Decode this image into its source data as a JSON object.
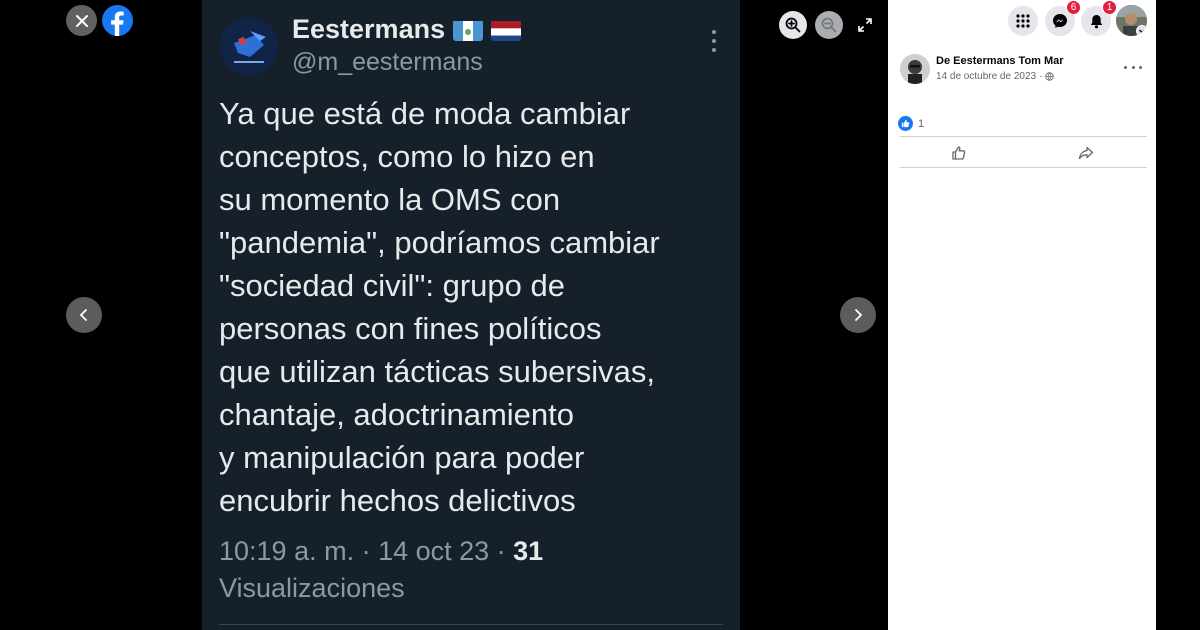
{
  "viewer": {
    "icons": {
      "close": "close-icon",
      "facebook": "facebook-logo",
      "zoom_in": "zoom-in-icon",
      "zoom_out": "zoom-out-icon",
      "fullscreen": "fullscreen-icon",
      "previous": "chevron-left-icon",
      "next": "chevron-right-icon"
    }
  },
  "tweet": {
    "display_name": "Eestermans",
    "flags": [
      "guatemala-flag",
      "netherlands-flag"
    ],
    "handle": "@m_eestermans",
    "text_lines": [
      "Ya que está de moda cambiar",
      "conceptos, como lo hizo en",
      "su momento la OMS con",
      "\"pandemia\", podríamos cambiar",
      "\"sociedad civil\": grupo de",
      "personas con fines políticos",
      "que utilizan tácticas subersivas,",
      "chantaje, adoctrinamiento",
      "y manipulación para poder",
      "encubrir hechos delictivos"
    ],
    "timestamp": "10:19 a. m. · 14 oct 23 · ",
    "views_count": "31",
    "views_label": "Visualizaciones",
    "colors": {
      "background": "#15202b",
      "text": "#e7e9ea",
      "muted": "#8b98a5"
    }
  },
  "topbar": {
    "menu_icon": "grid-menu-icon",
    "messenger_icon": "messenger-icon",
    "messenger_badge": "6",
    "notifications_icon": "bell-icon",
    "notifications_badge": "1",
    "account_icon": "account-avatar"
  },
  "post": {
    "author": "De Eestermans Tom Mar",
    "date": "14 de octubre de 2023",
    "audience_icon": "globe-icon",
    "more_icon": "more-horizontal-icon",
    "reaction_icon": "like-reaction-icon",
    "reaction_count": "1",
    "like_action_icon": "thumbs-up-icon",
    "share_action_icon": "share-icon"
  },
  "colors": {
    "facebook_blue": "#1877f2",
    "badge_red": "#e41e3f"
  }
}
